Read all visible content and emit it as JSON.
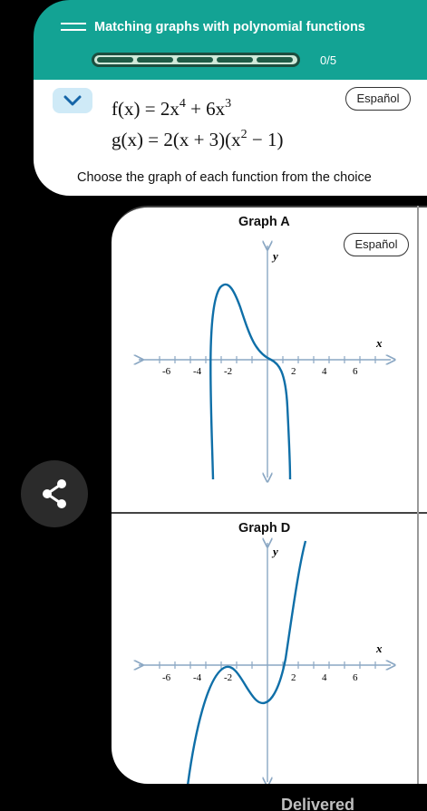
{
  "header": {
    "title": "Matching graphs with polynomial functions",
    "progress_label": "0/5",
    "progress_segments": 5,
    "progress_filled": 0
  },
  "problem": {
    "espanol_label": "Español",
    "f": {
      "lhs": "f(x) = 2x",
      "exp1": "4",
      "mid": " + 6x",
      "exp2": "3"
    },
    "g": {
      "lhs": "g(x) = 2(x + 3)(x",
      "exp1": "2",
      "rhs": " − 1)"
    },
    "instruction": "Choose the graph of each function from the choice"
  },
  "graph_a": {
    "title": "Graph A",
    "espanol_label": "Español",
    "x_axis_label": "x",
    "y_axis_label": "y",
    "x_ticks": [
      "-6",
      "-4",
      "-2",
      "2",
      "4",
      "6"
    ]
  },
  "graph_d": {
    "title": "Graph D",
    "x_axis_label": "x",
    "y_axis_label": "y",
    "x_ticks": [
      "-6",
      "-4",
      "-2",
      "2",
      "4",
      "6"
    ]
  },
  "footer": {
    "status": "Delivered"
  },
  "colors": {
    "header_bg": "#13a394",
    "curve": "#0f6fa8",
    "chevron_bg": "#cfeaf7"
  }
}
